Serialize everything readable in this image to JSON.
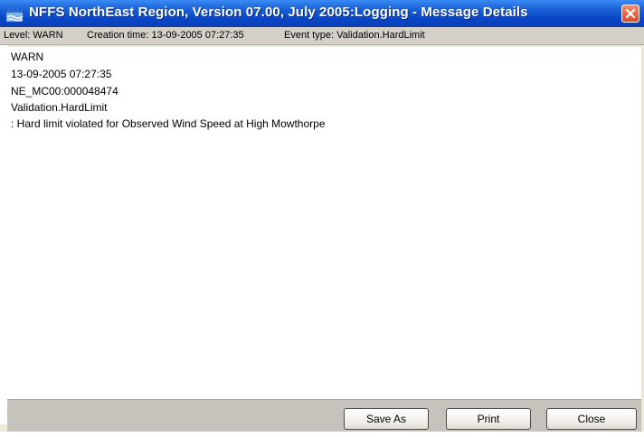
{
  "window": {
    "title": "NFFS NorthEast Region, Version 07.00, July 2005:Logging  - Message Details",
    "icon": "app-logo-icon",
    "close_icon": "close-icon"
  },
  "infobar": {
    "level": "Level: WARN",
    "creation_time": "Creation time: 13-09-2005 07:27:35",
    "event_type": "Event type: Validation.HardLimit"
  },
  "message": {
    "lines": [
      "WARN",
      "13-09-2005 07:27:35",
      "NE_MC00:000048474",
      "Validation.HardLimit",
      " : Hard limit violated for Observed Wind Speed at High Mowthorpe"
    ]
  },
  "buttons": {
    "save_as": "Save As",
    "print": "Print",
    "close": "Close"
  },
  "colors": {
    "titlebar": "#0846c8",
    "close_button": "#d94a2a",
    "infobar": "#d4d0c8",
    "bottom_bar": "#c6c3bc"
  }
}
